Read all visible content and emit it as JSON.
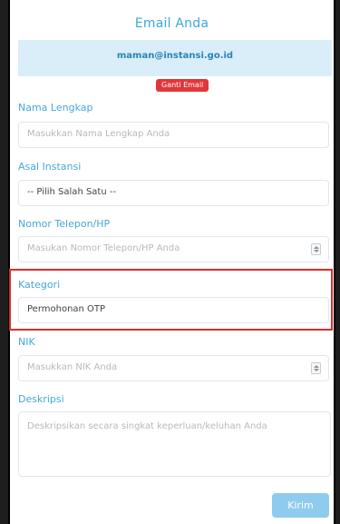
{
  "form": {
    "title": "Email Anda",
    "email": "maman@instansi.go.id",
    "change_email_label": "Ganti Email",
    "fields": {
      "nama": {
        "label": "Nama Lengkap",
        "placeholder": "Masukkan Nama Lengkap Anda"
      },
      "instansi": {
        "label": "Asal Instansi",
        "value": "-- Pilih Salah Satu --"
      },
      "telepon": {
        "label": "Nomor Telepon/HP",
        "placeholder": "Masukan Nomor Telepon/HP Anda"
      },
      "kategori": {
        "label": "Kategori",
        "value": "Permohonan OTP"
      },
      "nik": {
        "label": "NIK",
        "placeholder": "Masukkan NIK Anda"
      },
      "deskripsi": {
        "label": "Deskripsi",
        "placeholder": "Deskripsikan secara singkat keperluan/keluhan Anda"
      }
    },
    "submit_label": "Kirim"
  },
  "colors": {
    "accent": "#3aa8dc",
    "banner": "#d9eef8",
    "danger": "#e3363a",
    "highlight": "#e02b2b",
    "submit": "#8fcbee"
  }
}
